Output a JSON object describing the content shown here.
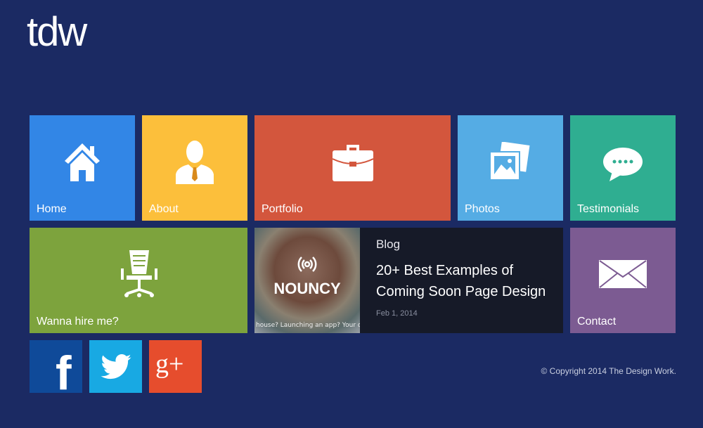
{
  "logo": "tdw",
  "tiles": {
    "home": {
      "label": "Home",
      "color": "#3286e6",
      "icon": "house-icon"
    },
    "about": {
      "label": "About",
      "color": "#fcbf3b",
      "icon": "person-icon"
    },
    "portfolio": {
      "label": "Portfolio",
      "color": "#d3563d",
      "icon": "briefcase-icon"
    },
    "photos": {
      "label": "Photos",
      "color": "#55ace4",
      "icon": "photos-icon"
    },
    "testimonials": {
      "label": "Testimonials",
      "color": "#2fae91",
      "icon": "speech-bubble-icon"
    },
    "hire": {
      "label": "Wanna hire me?",
      "color": "#7da33d",
      "icon": "office-chair-icon"
    },
    "contact": {
      "label": "Contact",
      "color": "#7c5b92",
      "icon": "envelope-icon"
    }
  },
  "blog": {
    "section": "Blog",
    "title_line1": "20+ Best Examples of",
    "title_line2": "Coming Soon Page Design",
    "date": "Feb 1, 2014",
    "image_brand": "NOUNCY",
    "image_snippet": "house? Launching an app? Your dog"
  },
  "social": [
    {
      "name": "facebook",
      "glyph": "f",
      "color": "#0f4a99"
    },
    {
      "name": "twitter",
      "color": "#18a9e3"
    },
    {
      "name": "google-plus",
      "glyph": "g+",
      "color": "#e64d2d"
    }
  ],
  "footer": {
    "copyright": "© Copyright 2014 The Design Work."
  }
}
